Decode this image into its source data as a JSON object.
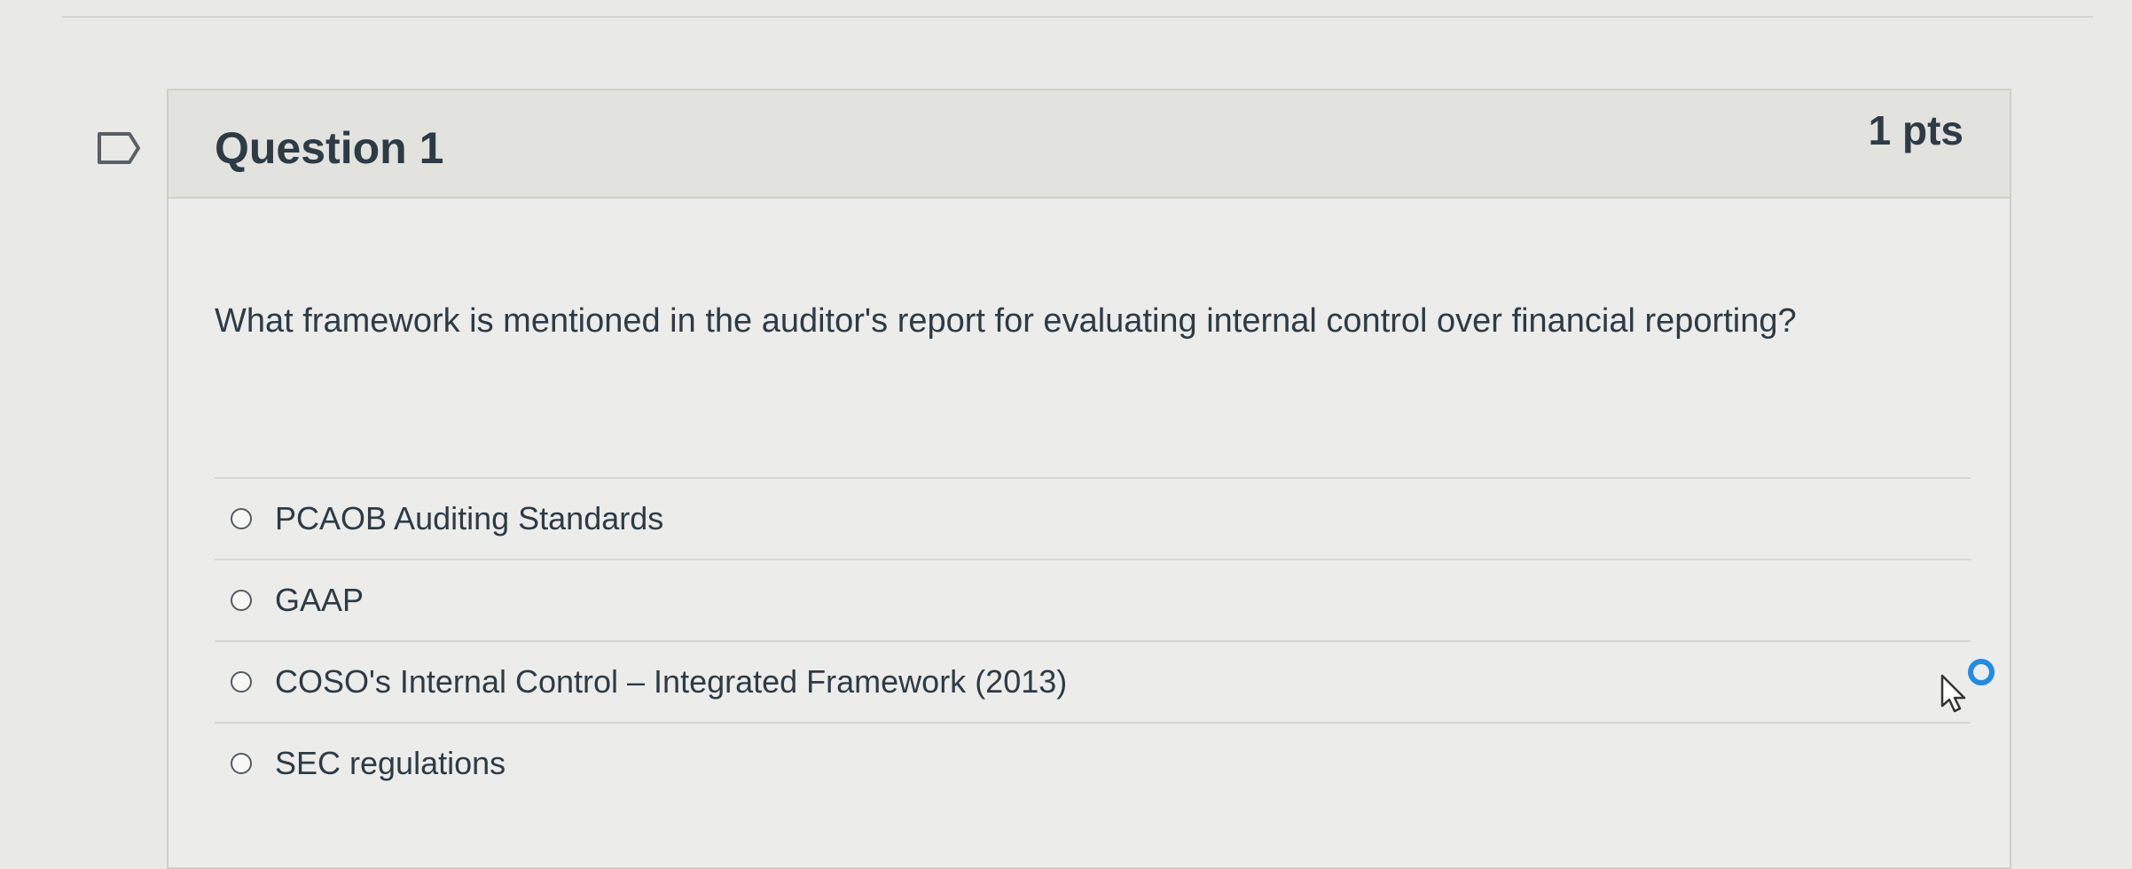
{
  "question": {
    "title": "Question 1",
    "points": "1 pts",
    "text": "What framework is mentioned in the auditor's report for evaluating internal control over financial reporting?",
    "flag_icon": "flag-outline-icon"
  },
  "answers": [
    {
      "label": "PCAOB Auditing Standards",
      "selected": false
    },
    {
      "label": "GAAP",
      "selected": false
    },
    {
      "label": "COSO's Internal Control – Integrated Framework (2013)",
      "selected": false
    },
    {
      "label": "SEC regulations",
      "selected": false
    }
  ],
  "colors": {
    "text": "#2d3b45",
    "card_bg": "#ececea",
    "header_bg": "#e2e2df",
    "border": "#cfcfcc",
    "focus_ring": "#1f8ce6"
  }
}
